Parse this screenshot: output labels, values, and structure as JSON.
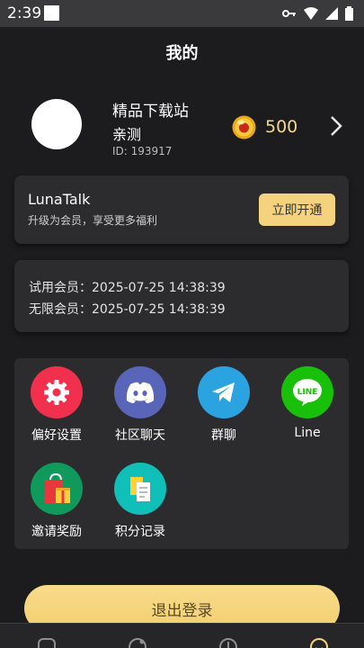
{
  "status_bar": {
    "time": "2:39"
  },
  "header": {
    "title": "我的"
  },
  "profile": {
    "name": "精品下载站",
    "nickname": "亲测",
    "id_text": "ID: 193917",
    "coins": "500"
  },
  "vip": {
    "title": "LunaTalk",
    "subtitle": "升级为会员，享受更多福利",
    "button_label": "立即开通"
  },
  "membership": {
    "trial": "试用会员：2025-07-25 14:38:39",
    "unlimited": "无限会员：2025-07-25 14:38:39"
  },
  "shortcuts": [
    {
      "label": "偏好设置",
      "icon": "gear-icon",
      "color": "#f0304c"
    },
    {
      "label": "社区聊天",
      "icon": "discord-icon",
      "color": "#5865b8"
    },
    {
      "label": "群聊",
      "icon": "telegram-icon",
      "color": "#2aa3e0"
    },
    {
      "label": "Line",
      "icon": "line-icon",
      "color": "#19c00a"
    },
    {
      "label": "邀请奖励",
      "icon": "gift-bag-icon",
      "color": "#0f9a5c"
    },
    {
      "label": "积分记录",
      "icon": "document-icon",
      "color": "#10bfb8"
    }
  ],
  "logout": {
    "label": "退出登录"
  },
  "colors": {
    "background": "#1c1c1e",
    "card": "#2c2c2e",
    "accent": "#f5d27e"
  }
}
